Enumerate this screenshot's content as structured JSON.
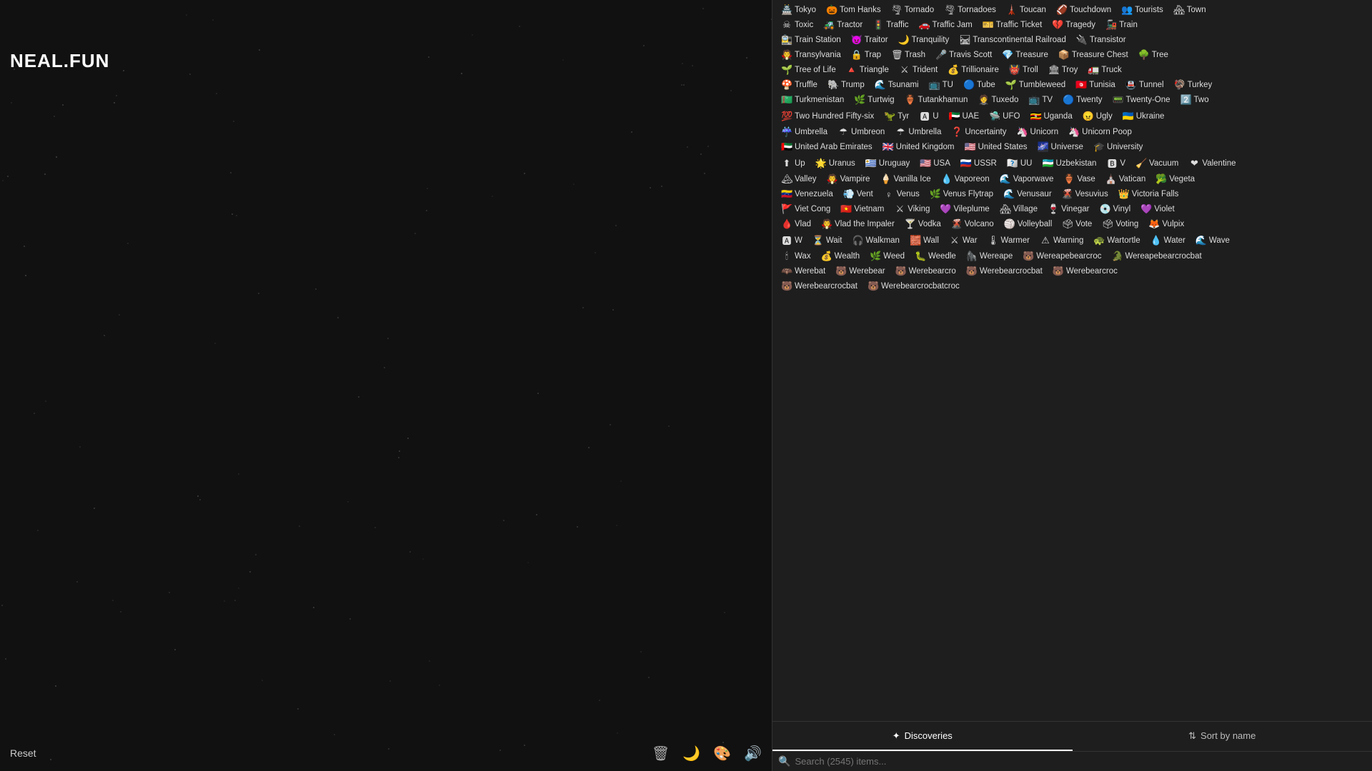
{
  "logo": "NEAL.FUN",
  "reset_label": "Reset",
  "search_placeholder": "Search (2545) items...",
  "tabs": [
    {
      "id": "discoveries",
      "label": "Discoveries",
      "icon": "✦",
      "active": true
    },
    {
      "id": "sort-by-name",
      "label": "Sort by name",
      "icon": "⇅",
      "active": false
    }
  ],
  "bottom_icons": [
    "🗑",
    "🌙",
    "🎨",
    "🔊"
  ],
  "items": [
    {
      "icon": "🏯",
      "label": "Tokyo"
    },
    {
      "icon": "🎃",
      "label": "Tom Hanks"
    },
    {
      "icon": "🌪",
      "label": "Tornado"
    },
    {
      "icon": "🌪",
      "label": "Tornadoes"
    },
    {
      "icon": "🗼",
      "label": "Toucan"
    },
    {
      "icon": "🏈",
      "label": "Touchdown"
    },
    {
      "icon": "👥",
      "label": "Tourists"
    },
    {
      "icon": "🏘",
      "label": "Town"
    },
    {
      "icon": "☠",
      "label": "Toxic"
    },
    {
      "icon": "🚜",
      "label": "Tractor"
    },
    {
      "icon": "🚦",
      "label": "Traffic"
    },
    {
      "icon": "🚗",
      "label": "Traffic Jam"
    },
    {
      "icon": "🎫",
      "label": "Traffic Ticket"
    },
    {
      "icon": "💔",
      "label": "Tragedy"
    },
    {
      "icon": "🚂",
      "label": "Train"
    },
    {
      "icon": "🚉",
      "label": "Train Station"
    },
    {
      "icon": "😈",
      "label": "Traitor"
    },
    {
      "icon": "🌙",
      "label": "Tranquility"
    },
    {
      "icon": "🛤",
      "label": "Transcontinental Railroad"
    },
    {
      "icon": "🔌",
      "label": "Transistor"
    },
    {
      "icon": "🧛",
      "label": "Transylvania"
    },
    {
      "icon": "🔒",
      "label": "Trap"
    },
    {
      "icon": "🗑",
      "label": "Trash"
    },
    {
      "icon": "🎤",
      "label": "Travis Scott"
    },
    {
      "icon": "💎",
      "label": "Treasure"
    },
    {
      "icon": "📦",
      "label": "Treasure Chest"
    },
    {
      "icon": "🌳",
      "label": "Tree"
    },
    {
      "icon": "🌱",
      "label": "Tree of Life"
    },
    {
      "icon": "🔺",
      "label": "Triangle"
    },
    {
      "icon": "⚔",
      "label": "Trident"
    },
    {
      "icon": "💰",
      "label": "Trillionaire"
    },
    {
      "icon": "👹",
      "label": "Troll"
    },
    {
      "icon": "🏛",
      "label": "Troy"
    },
    {
      "icon": "🚛",
      "label": "Truck"
    },
    {
      "icon": "🍄",
      "label": "Truffle"
    },
    {
      "icon": "🐘",
      "label": "Trump"
    },
    {
      "icon": "🌊",
      "label": "Tsunami"
    },
    {
      "icon": "📺",
      "label": "TU"
    },
    {
      "icon": "🔵",
      "label": "Tube"
    },
    {
      "icon": "🌱",
      "label": "Tumbleweed"
    },
    {
      "icon": "🇹🇳",
      "label": "Tunisia"
    },
    {
      "icon": "🚇",
      "label": "Tunnel"
    },
    {
      "icon": "🦃",
      "label": "Turkey"
    },
    {
      "icon": "🇹🇲",
      "label": "Turkmenistan"
    },
    {
      "icon": "🌿",
      "label": "Turtwig"
    },
    {
      "icon": "🏺",
      "label": "Tutankhamun"
    },
    {
      "icon": "🤵",
      "label": "Tuxedo"
    },
    {
      "icon": "📺",
      "label": "TV"
    },
    {
      "icon": "🔵",
      "label": "Twenty"
    },
    {
      "icon": "📟",
      "label": "Twenty-One"
    },
    {
      "icon": "2️⃣",
      "label": "Two"
    },
    {
      "icon": "💯",
      "label": "Two Hundred Fifty-six"
    },
    {
      "icon": "🦖",
      "label": "Tyr"
    },
    {
      "icon": "🅰",
      "label": "U"
    },
    {
      "icon": "🇦🇪",
      "label": "UAE"
    },
    {
      "icon": "🛸",
      "label": "UFO"
    },
    {
      "icon": "🇺🇬",
      "label": "Uganda"
    },
    {
      "icon": "😠",
      "label": "Ugly"
    },
    {
      "icon": "🇺🇦",
      "label": "Ukraine"
    },
    {
      "icon": "☔",
      "label": "Umbrella"
    },
    {
      "icon": "☂",
      "label": "Umbreon"
    },
    {
      "icon": "☂",
      "label": "Umbrella"
    },
    {
      "icon": "❓",
      "label": "Uncertainty"
    },
    {
      "icon": "🦄",
      "label": "Unicorn"
    },
    {
      "icon": "🦄",
      "label": "Unicorn Poop"
    },
    {
      "icon": "🇦🇪",
      "label": "United Arab Emirates"
    },
    {
      "icon": "🇬🇧",
      "label": "United Kingdom"
    },
    {
      "icon": "🇺🇸",
      "label": "United States"
    },
    {
      "icon": "🌌",
      "label": "Universe"
    },
    {
      "icon": "🎓",
      "label": "University"
    },
    {
      "icon": "⬆",
      "label": "Up"
    },
    {
      "icon": "🌟",
      "label": "Uranus"
    },
    {
      "icon": "🇺🇾",
      "label": "Uruguay"
    },
    {
      "icon": "🇺🇸",
      "label": "USA"
    },
    {
      "icon": "🇷🇺",
      "label": "USSR"
    },
    {
      "icon": "🇺🇺",
      "label": "UU"
    },
    {
      "icon": "🇺🇿",
      "label": "Uzbekistan"
    },
    {
      "icon": "🅱",
      "label": "V"
    },
    {
      "icon": "🧹",
      "label": "Vacuum"
    },
    {
      "icon": "❤",
      "label": "Valentine"
    },
    {
      "icon": "🏔",
      "label": "Valley"
    },
    {
      "icon": "🧛",
      "label": "Vampire"
    },
    {
      "icon": "🍦",
      "label": "Vanilla Ice"
    },
    {
      "icon": "💧",
      "label": "Vaporeon"
    },
    {
      "icon": "🌊",
      "label": "Vaporwave"
    },
    {
      "icon": "🏺",
      "label": "Vase"
    },
    {
      "icon": "⛪",
      "label": "Vatican"
    },
    {
      "icon": "🥦",
      "label": "Vegeta"
    },
    {
      "icon": "🇻🇪",
      "label": "Venezuela"
    },
    {
      "icon": "💨",
      "label": "Vent"
    },
    {
      "icon": "♀",
      "label": "Venus"
    },
    {
      "icon": "🌿",
      "label": "Venus Flytrap"
    },
    {
      "icon": "🌊",
      "label": "Venusaur"
    },
    {
      "icon": "🌋",
      "label": "Vesuvius"
    },
    {
      "icon": "👑",
      "label": "Victoria Falls"
    },
    {
      "icon": "🚩",
      "label": "Viet Cong"
    },
    {
      "icon": "🇻🇳",
      "label": "Vietnam"
    },
    {
      "icon": "⚔",
      "label": "Viking"
    },
    {
      "icon": "💜",
      "label": "Vileplume"
    },
    {
      "icon": "🏘",
      "label": "Village"
    },
    {
      "icon": "🍷",
      "label": "Vinegar"
    },
    {
      "icon": "💿",
      "label": "Vinyl"
    },
    {
      "icon": "💜",
      "label": "Violet"
    },
    {
      "icon": "🩸",
      "label": "Vlad"
    },
    {
      "icon": "🧛",
      "label": "Vlad the Impaler"
    },
    {
      "icon": "🍸",
      "label": "Vodka"
    },
    {
      "icon": "🌋",
      "label": "Volcano"
    },
    {
      "icon": "🏐",
      "label": "Volleyball"
    },
    {
      "icon": "🗳",
      "label": "Vote"
    },
    {
      "icon": "🗳",
      "label": "Voting"
    },
    {
      "icon": "🦊",
      "label": "Vulpix"
    },
    {
      "icon": "🅰",
      "label": "W"
    },
    {
      "icon": "⏳",
      "label": "Wait"
    },
    {
      "icon": "🎧",
      "label": "Walkman"
    },
    {
      "icon": "🧱",
      "label": "Wall"
    },
    {
      "icon": "⚔",
      "label": "War"
    },
    {
      "icon": "🌡",
      "label": "Warmer"
    },
    {
      "icon": "⚠",
      "label": "Warning"
    },
    {
      "icon": "🐢",
      "label": "Wartortle"
    },
    {
      "icon": "💧",
      "label": "Water"
    },
    {
      "icon": "🌊",
      "label": "Wave"
    },
    {
      "icon": "🕯",
      "label": "Wax"
    },
    {
      "icon": "💰",
      "label": "Wealth"
    },
    {
      "icon": "🌿",
      "label": "Weed"
    },
    {
      "icon": "🐛",
      "label": "Weedle"
    },
    {
      "icon": "🦍",
      "label": "Wereape"
    },
    {
      "icon": "🐻",
      "label": "Wereapebearcroc"
    },
    {
      "icon": "🐊",
      "label": "Wereapebearcrocbat"
    },
    {
      "icon": "🦇",
      "label": "Werebat"
    },
    {
      "icon": "🐻",
      "label": "Werebear"
    },
    {
      "icon": "🐻",
      "label": "Werebearcro"
    },
    {
      "icon": "🐻",
      "label": "Werebearcrocbat"
    },
    {
      "icon": "🐻",
      "label": "Werebearcroc"
    },
    {
      "icon": "🐻",
      "label": "Werebearcrocbat"
    },
    {
      "icon": "🐻",
      "label": "Werebearcrocbatcroc"
    }
  ]
}
